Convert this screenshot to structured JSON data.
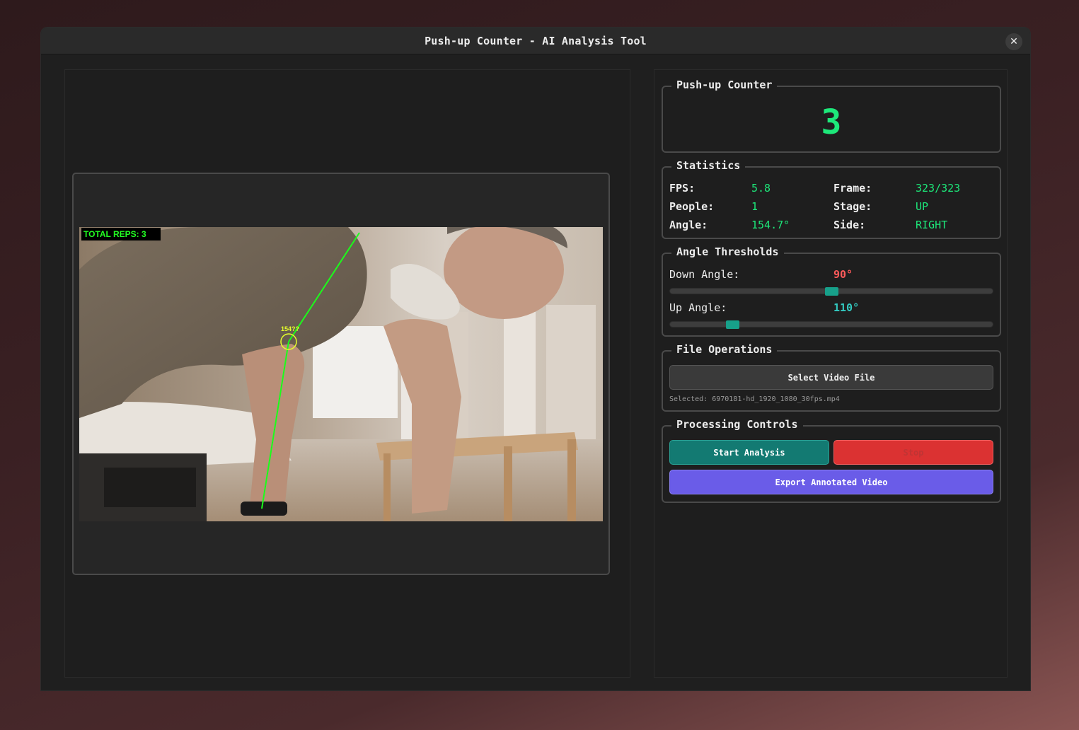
{
  "window": {
    "title": "Push-up Counter - AI Analysis Tool",
    "close_label": "✕"
  },
  "video": {
    "overlay_reps": "TOTAL REPS: 3",
    "overlay_angle": "154??"
  },
  "counter": {
    "title": "Push-up Counter",
    "value": "3"
  },
  "statistics": {
    "title": "Statistics",
    "fps_label": "FPS:",
    "fps_value": "5.8",
    "frame_label": "Frame:",
    "frame_value": "323/323",
    "people_label": "People:",
    "people_value": "1",
    "stage_label": "Stage:",
    "stage_value": "UP",
    "angle_label": "Angle:",
    "angle_value": "154.7°",
    "side_label": "Side:",
    "side_value": "RIGHT"
  },
  "thresholds": {
    "title": "Angle Thresholds",
    "down_label": "Down Angle:",
    "down_value": "90°",
    "down_color": "#ff5a5a",
    "down_fraction": 0.5,
    "up_label": "Up Angle:",
    "up_value": "110°",
    "up_color": "#33c9c0",
    "up_fraction": 0.18
  },
  "file_ops": {
    "title": "File Operations",
    "select_label": "Select Video File",
    "selected_text": "Selected: 6970181-hd_1920_1080_30fps.mp4"
  },
  "processing": {
    "title": "Processing Controls",
    "start_label": "Start Analysis",
    "stop_label": "Stop",
    "export_label": "Export Annotated Video",
    "start_color": "#137a72",
    "stop_color": "#db3232",
    "export_color": "#6a5ce8"
  }
}
